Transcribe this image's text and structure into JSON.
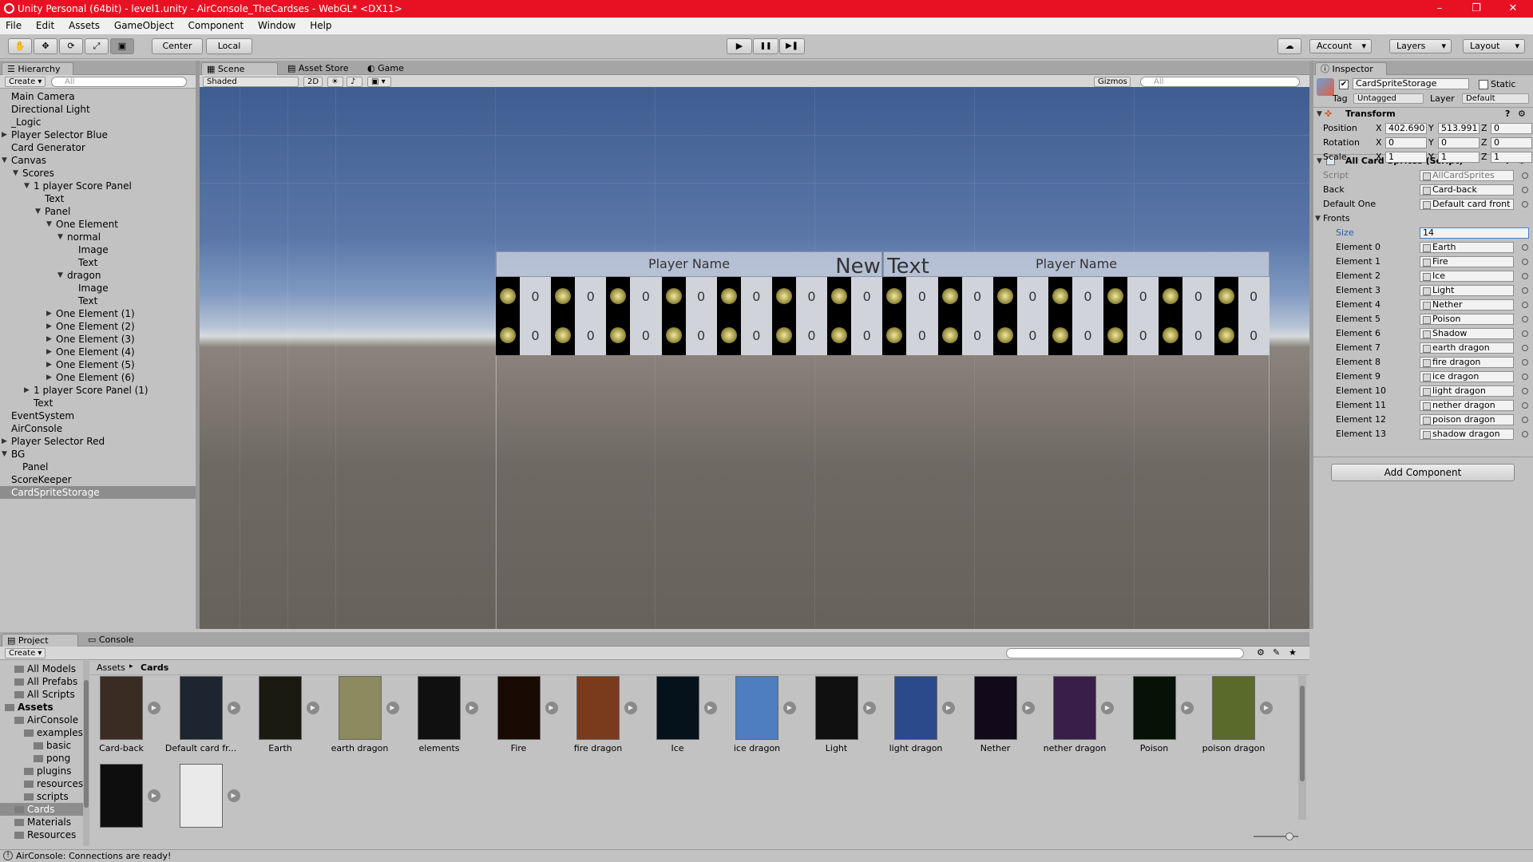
{
  "window": {
    "title": "Unity Personal (64bit) - level1.unity - AirConsole_TheCardses - WebGL* <DX11>",
    "min": "–",
    "max": "❐",
    "close": "✕"
  },
  "menu": [
    "File",
    "Edit",
    "Assets",
    "GameObject",
    "Component",
    "Window",
    "Help"
  ],
  "toolbar": {
    "tools": [
      "hand-tool",
      "move-tool",
      "rotate-tool",
      "scale-tool",
      "rect-tool"
    ],
    "pivot": "Center",
    "space": "Local",
    "play": "▶",
    "pause": "❚❚",
    "step": "▶❚",
    "account": "Account",
    "layers": "Layers",
    "layout": "Layout"
  },
  "hierarchy": {
    "tab": "Hierarchy",
    "create": "Create",
    "search_placeholder": "All",
    "items": [
      {
        "label": "Main Camera",
        "depth": 0,
        "arrow": ""
      },
      {
        "label": "Directional Light",
        "depth": 0,
        "arrow": ""
      },
      {
        "label": "_Logic",
        "depth": 0,
        "arrow": ""
      },
      {
        "label": "Player Selector Blue",
        "depth": 0,
        "arrow": "▶"
      },
      {
        "label": "Card Generator",
        "depth": 0,
        "arrow": ""
      },
      {
        "label": "Canvas",
        "depth": 0,
        "arrow": "▼"
      },
      {
        "label": "Scores",
        "depth": 1,
        "arrow": "▼"
      },
      {
        "label": "1 player Score Panel",
        "depth": 2,
        "arrow": "▼"
      },
      {
        "label": "Text",
        "depth": 3,
        "arrow": ""
      },
      {
        "label": "Panel",
        "depth": 3,
        "arrow": "▼"
      },
      {
        "label": "One Element",
        "depth": 4,
        "arrow": "▼"
      },
      {
        "label": "normal",
        "depth": 5,
        "arrow": "▼"
      },
      {
        "label": "Image",
        "depth": 6,
        "arrow": ""
      },
      {
        "label": "Text",
        "depth": 6,
        "arrow": ""
      },
      {
        "label": "dragon",
        "depth": 5,
        "arrow": "▼"
      },
      {
        "label": "Image",
        "depth": 6,
        "arrow": ""
      },
      {
        "label": "Text",
        "depth": 6,
        "arrow": ""
      },
      {
        "label": "One Element (1)",
        "depth": 4,
        "arrow": "▶"
      },
      {
        "label": "One Element (2)",
        "depth": 4,
        "arrow": "▶"
      },
      {
        "label": "One Element (3)",
        "depth": 4,
        "arrow": "▶"
      },
      {
        "label": "One Element (4)",
        "depth": 4,
        "arrow": "▶"
      },
      {
        "label": "One Element (5)",
        "depth": 4,
        "arrow": "▶"
      },
      {
        "label": "One Element (6)",
        "depth": 4,
        "arrow": "▶"
      },
      {
        "label": "1 player Score Panel (1)",
        "depth": 2,
        "arrow": "▶"
      },
      {
        "label": "Text",
        "depth": 2,
        "arrow": ""
      },
      {
        "label": "EventSystem",
        "depth": 0,
        "arrow": ""
      },
      {
        "label": "AirConsole",
        "depth": 0,
        "arrow": ""
      },
      {
        "label": "Player Selector Red",
        "depth": 0,
        "arrow": "▶"
      },
      {
        "label": "BG",
        "depth": 0,
        "arrow": "▼"
      },
      {
        "label": "Panel",
        "depth": 1,
        "arrow": ""
      },
      {
        "label": "ScoreKeeper",
        "depth": 0,
        "arrow": ""
      },
      {
        "label": "CardSpriteStorage",
        "depth": 0,
        "arrow": "",
        "selected": true
      }
    ]
  },
  "scene": {
    "tabs": [
      "Scene",
      "Asset Store",
      "Game"
    ],
    "shading": "Shaded",
    "mode2d": "2D",
    "gizmos": "Gizmos",
    "search_placeholder": "All",
    "panel_left_title": "Player Name",
    "panel_right_title": "Player Name",
    "center_text": "New Text",
    "score_value": "0"
  },
  "inspector": {
    "tab": "Inspector",
    "object_name": "CardSpriteStorage",
    "static_label": "Static",
    "tag_label": "Tag",
    "tag_value": "Untagged",
    "layer_label": "Layer",
    "layer_value": "Default",
    "transform": {
      "title": "Transform",
      "position": {
        "label": "Position",
        "x": "402.690",
        "y": "513.991",
        "z": "0"
      },
      "rotation": {
        "label": "Rotation",
        "x": "0",
        "y": "0",
        "z": "0"
      },
      "scale": {
        "label": "Scale",
        "x": "1",
        "y": "1",
        "z": "1"
      }
    },
    "component": {
      "title": "All Card Sprites (Script)",
      "script_label": "Script",
      "script_value": "AllCardSprites",
      "back_label": "Back",
      "back_value": "Card-back",
      "default_label": "Default One",
      "default_value": "Default card front",
      "fronts_label": "Fronts",
      "size_label": "Size",
      "size_value": "14",
      "elements": [
        {
          "label": "Element 0",
          "value": "Earth"
        },
        {
          "label": "Element 1",
          "value": "Fire"
        },
        {
          "label": "Element 2",
          "value": "Ice"
        },
        {
          "label": "Element 3",
          "value": "Light"
        },
        {
          "label": "Element 4",
          "value": "Nether"
        },
        {
          "label": "Element 5",
          "value": "Poison"
        },
        {
          "label": "Element 6",
          "value": "Shadow"
        },
        {
          "label": "Element 7",
          "value": "earth dragon"
        },
        {
          "label": "Element 8",
          "value": "fire dragon"
        },
        {
          "label": "Element 9",
          "value": "ice dragon"
        },
        {
          "label": "Element 10",
          "value": "light dragon"
        },
        {
          "label": "Element 11",
          "value": "nether dragon"
        },
        {
          "label": "Element 12",
          "value": "poison dragon"
        },
        {
          "label": "Element 13",
          "value": "shadow dragon"
        }
      ]
    },
    "add_component": "Add Component"
  },
  "project": {
    "tabs": [
      "Project",
      "Console"
    ],
    "create": "Create",
    "breadcrumb_root": "Assets",
    "breadcrumb_sep": "▸",
    "breadcrumb_current": "Cards",
    "tree": [
      {
        "label": "All Models",
        "depth": 1
      },
      {
        "label": "All Prefabs",
        "depth": 1
      },
      {
        "label": "All Scripts",
        "depth": 1
      },
      {
        "label": "Assets",
        "depth": 0,
        "bold": true
      },
      {
        "label": "AirConsole",
        "depth": 1
      },
      {
        "label": "examples",
        "depth": 2
      },
      {
        "label": "basic",
        "depth": 3
      },
      {
        "label": "pong",
        "depth": 3
      },
      {
        "label": "plugins",
        "depth": 2
      },
      {
        "label": "resources",
        "depth": 2
      },
      {
        "label": "scripts",
        "depth": 2
      },
      {
        "label": "Cards",
        "depth": 1,
        "selected": true
      },
      {
        "label": "Materials",
        "depth": 1
      },
      {
        "label": "Resources",
        "depth": 1
      }
    ],
    "assets": [
      {
        "label": "Card-back",
        "color": "#3a2c22"
      },
      {
        "label": "Default card fr...",
        "color": "#1d2530"
      },
      {
        "label": "Earth",
        "color": "#1a1a10"
      },
      {
        "label": "earth dragon",
        "color": "#8c8a5e"
      },
      {
        "label": "elements",
        "color": "#101010"
      },
      {
        "label": "Fire",
        "color": "#1a0a04"
      },
      {
        "label": "fire dragon",
        "color": "#7a3a1c"
      },
      {
        "label": "Ice",
        "color": "#05121c"
      },
      {
        "label": "ice dragon",
        "color": "#4e7ec0"
      },
      {
        "label": "Light",
        "color": "#101010"
      },
      {
        "label": "light dragon",
        "color": "#2a4a8c"
      },
      {
        "label": "Nether",
        "color": "#120a1a"
      },
      {
        "label": "nether dragon",
        "color": "#3a1e4a"
      },
      {
        "label": "Poison",
        "color": "#051205"
      },
      {
        "label": "poison dragon",
        "color": "#5a6a2a"
      },
      {
        "label": "",
        "color": "#0e0e0e"
      },
      {
        "label": "",
        "color": "#eaeaea"
      }
    ]
  },
  "status": {
    "message": "AirConsole: Connections are ready!"
  }
}
